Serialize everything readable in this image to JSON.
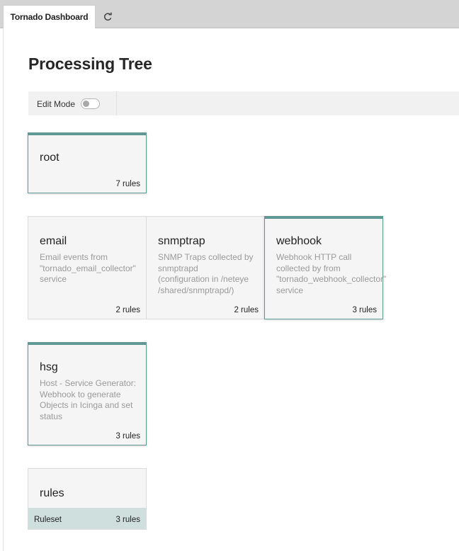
{
  "tabs": {
    "active_label": "Tornado Dashboard",
    "reload_icon": "reload-icon"
  },
  "page": {
    "title": "Processing Tree"
  },
  "toolbar": {
    "edit_mode_label": "Edit Mode",
    "edit_mode_on": false
  },
  "nodes": {
    "root": {
      "name": "root",
      "count": "7 rules"
    },
    "email": {
      "name": "email",
      "description": "Email events from\n\"tornado_email_collector\"\nservice",
      "count": "2 rules"
    },
    "snmptrap": {
      "name": "snmptrap",
      "description": "SNMP Traps collected by\nsnmptrapd\n(configuration in /neteye\n/shared/snmptrapd/)",
      "count": "2 rules"
    },
    "webhook": {
      "name": "webhook",
      "description": "Webhook HTTP call\ncollected by from\n\"tornado_webhook_collector\"\nservice",
      "count": "3 rules"
    },
    "hsg": {
      "name": "hsg",
      "description": "Host - Service Generator:\nWebhook to generate\nObjects in Icinga and set\nstatus",
      "count": "3 rules"
    },
    "rules": {
      "name": "rules",
      "type_label": "Ruleset",
      "count": "3 rules"
    }
  },
  "colors": {
    "accent": "#5f9894",
    "ruleset_bar": "#cfdfdd",
    "card_bg": "#f5f5f5"
  }
}
